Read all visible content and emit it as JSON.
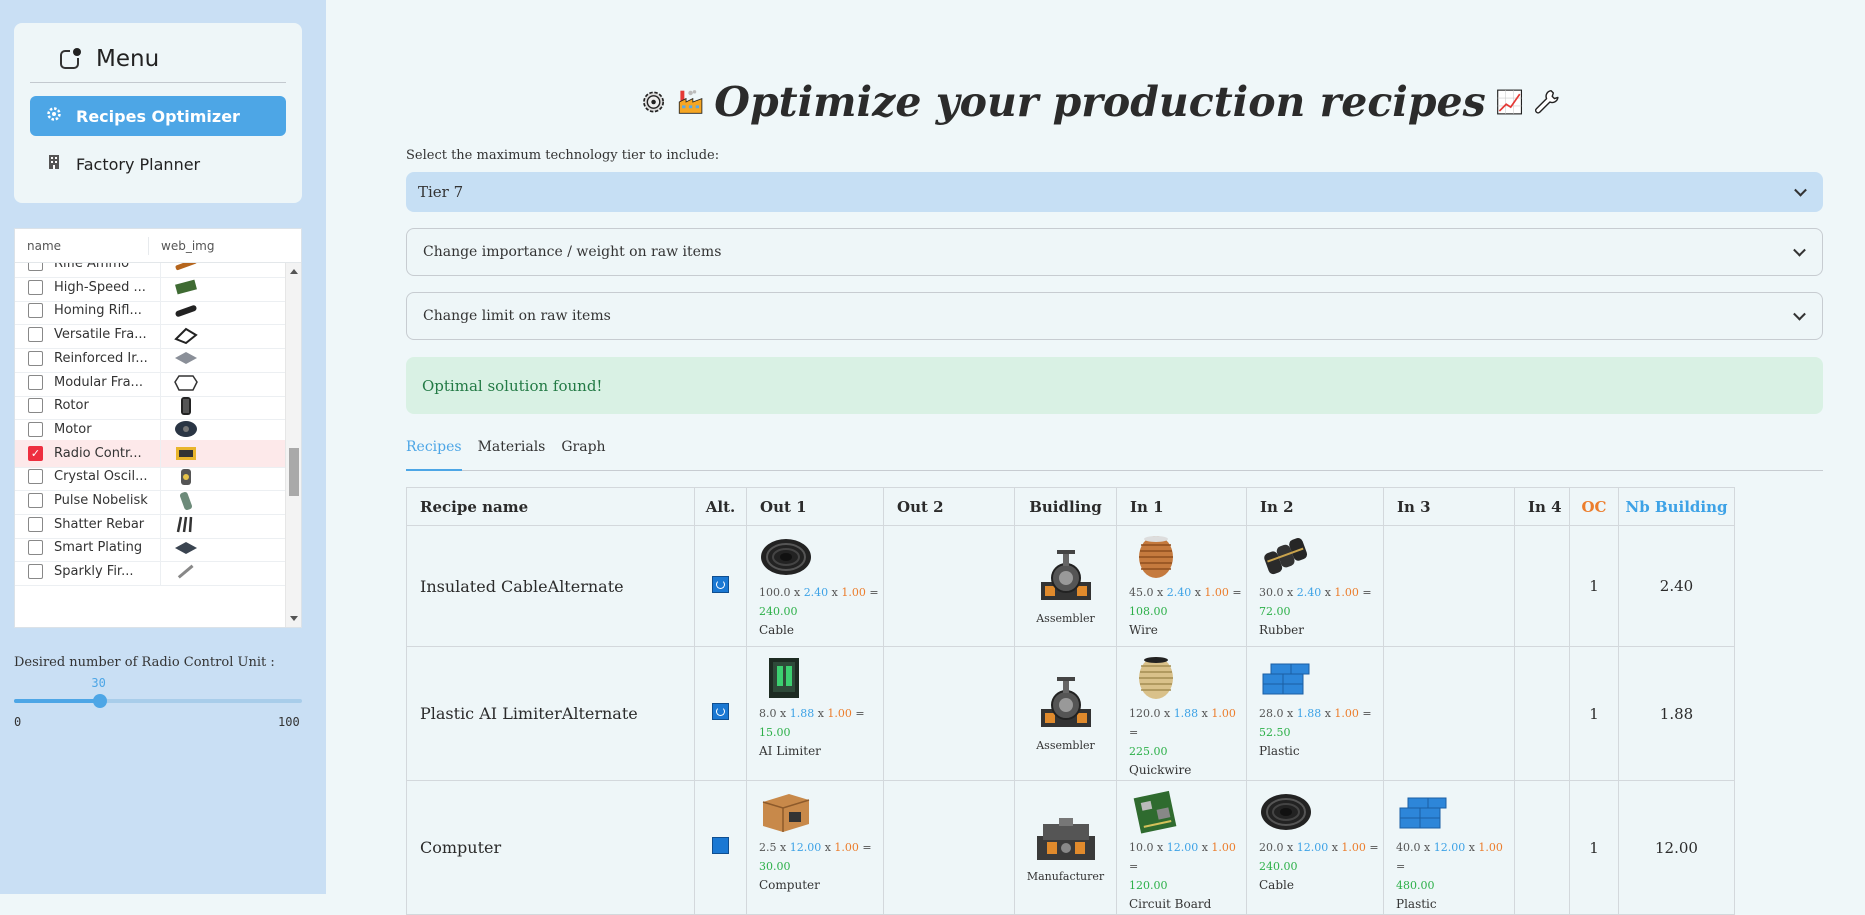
{
  "sidebar": {
    "menu_title": "Menu",
    "nav": [
      {
        "label": "Recipes Optimizer",
        "icon": "gear-icon",
        "active": true
      },
      {
        "label": "Factory Planner",
        "icon": "building-icon",
        "active": false
      }
    ],
    "dataframe": {
      "columns": [
        "name",
        "web_img"
      ],
      "rows": [
        {
          "name": "Rifle Ammo",
          "checked": false
        },
        {
          "name": "High-Speed ...",
          "checked": false
        },
        {
          "name": "Homing Rifl...",
          "checked": false
        },
        {
          "name": "Versatile Fra...",
          "checked": false
        },
        {
          "name": "Reinforced Ir...",
          "checked": false
        },
        {
          "name": "Modular Fra...",
          "checked": false
        },
        {
          "name": "Rotor",
          "checked": false
        },
        {
          "name": "Motor",
          "checked": false
        },
        {
          "name": "Radio Contr...",
          "checked": true
        },
        {
          "name": "Crystal Oscil...",
          "checked": false
        },
        {
          "name": "Pulse Nobelisk",
          "checked": false
        },
        {
          "name": "Shatter Rebar",
          "checked": false
        },
        {
          "name": "Smart Plating",
          "checked": false
        },
        {
          "name": "Sparkly Fir...",
          "checked": false
        }
      ]
    },
    "slider": {
      "label": "Desired number of Radio Control Unit :",
      "value": "30",
      "min": "0",
      "max": "100",
      "fraction": 0.3
    }
  },
  "main": {
    "title": "Optimize your production recipes",
    "tier_label": "Select the maximum technology tier to include:",
    "tier_value": "Tier 7",
    "expanders": [
      "Change importance / weight on raw items",
      "Change limit on raw items"
    ],
    "success": "Optimal solution found!",
    "tabs": [
      "Recipes",
      "Materials",
      "Graph"
    ],
    "table": {
      "headers": [
        "Recipe name",
        "Alt.",
        "Out 1",
        "Out 2",
        "Buidling",
        "In 1",
        "In 2",
        "In 3",
        "In 4",
        "OC",
        "Nb Building"
      ],
      "rows": [
        {
          "name": "Insulated CableAlternate",
          "alt": true,
          "out1": {
            "qty": "100.0",
            "rate": "2.40",
            "oc": "1.00",
            "total": "240.00",
            "item": "Cable"
          },
          "building": "Assembler",
          "in1": {
            "qty": "45.0",
            "rate": "2.40",
            "oc": "1.00",
            "total": "108.00",
            "item": "Wire"
          },
          "in2": {
            "qty": "30.0",
            "rate": "2.40",
            "oc": "1.00",
            "total": "72.00",
            "item": "Rubber"
          },
          "oc": "1",
          "nb": "2.40"
        },
        {
          "name": "Plastic AI LimiterAlternate",
          "alt": true,
          "out1": {
            "qty": "8.0",
            "rate": "1.88",
            "oc": "1.00",
            "total": "15.00",
            "item": "AI Limiter"
          },
          "building": "Assembler",
          "in1": {
            "qty": "120.0",
            "rate": "1.88",
            "oc": "1.00",
            "total": "225.00",
            "item": "Quickwire"
          },
          "in2": {
            "qty": "28.0",
            "rate": "1.88",
            "oc": "1.00",
            "total": "52.50",
            "item": "Plastic"
          },
          "oc": "1",
          "nb": "1.88"
        },
        {
          "name": "Computer",
          "alt": false,
          "out1": {
            "qty": "2.5",
            "rate": "12.00",
            "oc": "1.00",
            "total": "30.00",
            "item": "Computer"
          },
          "building": "Manufacturer",
          "in1": {
            "qty": "10.0",
            "rate": "12.00",
            "oc": "1.00",
            "total": "120.00",
            "item": "Circuit Board"
          },
          "in2": {
            "qty": "20.0",
            "rate": "12.00",
            "oc": "1.00",
            "total": "240.00",
            "item": "Cable"
          },
          "in3": {
            "qty": "40.0",
            "rate": "12.00",
            "oc": "1.00",
            "total": "480.00",
            "item": "Plastic"
          },
          "oc": "1",
          "nb": "12.00"
        }
      ]
    }
  },
  "colors": {
    "accent": "#4da6e6",
    "oc": "#ec7d2c",
    "total": "#2db049",
    "selected": "#ee2e3f"
  }
}
